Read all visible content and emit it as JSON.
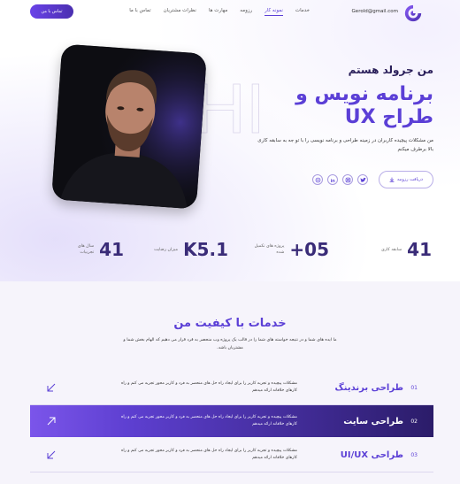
{
  "header": {
    "email": "Gerold@gmail.com",
    "nav": [
      "خدمات",
      "نمونه کار",
      "رزومه",
      "مهارت ها",
      "نظرات مشتریان",
      "تماس با ما"
    ],
    "active_nav_index": 1,
    "contact_button": "تماس با من"
  },
  "hero": {
    "greeting": "من جرولد هستم",
    "title": "برنامه نویس و طراح UX",
    "description": "من مشکلات پیچیده کاربران در زمینه طراحی و برنامه نویسی را با تو جه به سابقه کاری بالا برطرف میکنم",
    "resume_button": "دریافت رزومه",
    "socials": [
      "twitter-icon",
      "linkedin-icon",
      "instagram-icon",
      "github-icon"
    ],
    "ghost_text": "HI"
  },
  "stats": [
    {
      "value": "41",
      "label": "سابقه کاری"
    },
    {
      "value": "+05",
      "label": "پروژه های تکمیل شده"
    },
    {
      "value": "K5.1",
      "label": "میزان رضایت"
    },
    {
      "value": "41",
      "label": "سال های تجربیات"
    }
  ],
  "services": {
    "title": "خدمات با کیفیت من",
    "description": "ما ایده های شما و در نتیجه خواسته های شما را در قالب یک پروژه وب منحصر به فرد قرار می دهیم که الهام بخش شما و مشتریان باشد.",
    "items": [
      {
        "index": "01",
        "name": "طراحی برندینگ",
        "text": "مشکلات پیچیده و تجربه کاربر را برای ایجاد راه حل های منحصر به فرد و کاربر محور تجربه می کنم و راه کارهای خلاقانه ارائه میدهم"
      },
      {
        "index": "02",
        "name": "طراحی سایت",
        "text": "مشکلات پیچیده و تجربه کاربر را برای ایجاد راه حل های منحصر به فرد و کاربر محور تجربه می کنم و راه کارهای خلاقانه ارائه میدهم"
      },
      {
        "index": "03",
        "name": "طراحی UI/UX",
        "text": "مشکلات پیچیده و تجربه کاربر را برای ایجاد راه حل های منحصر به فرد و کاربر محور تجربه می کنم و راه کارهای خلاقانه ارائه میدهم"
      }
    ],
    "active_index": 1
  },
  "colors": {
    "accent": "#5b3fd6",
    "accent_dark": "#2b1c69",
    "text": "#1b1438"
  }
}
